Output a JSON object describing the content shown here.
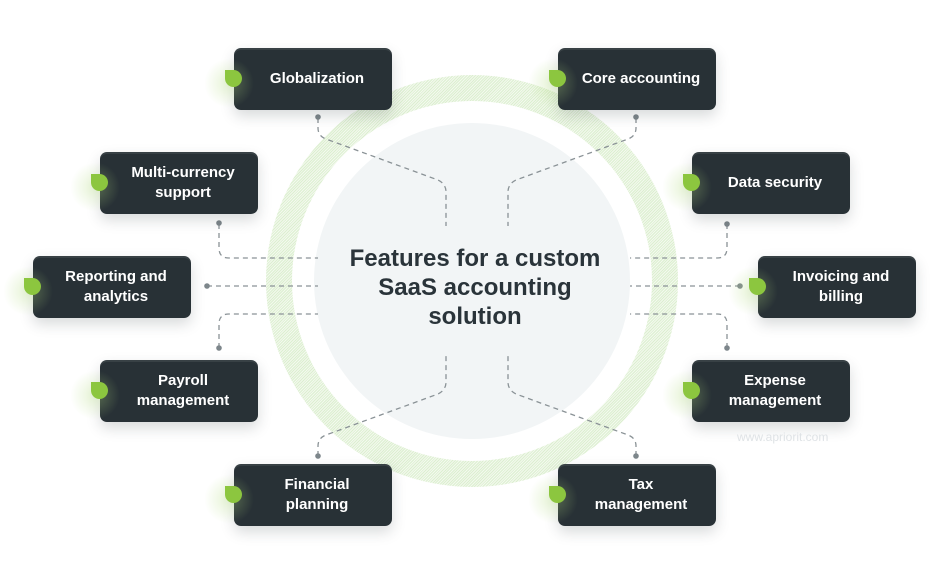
{
  "diagram": {
    "title": "Features for a custom SaaS accounting solution",
    "title_lines": [
      "Features for a custom",
      "SaaS accounting",
      "solution"
    ],
    "watermark": "www.apriorit.com",
    "colors": {
      "node_bg": "#283136",
      "accent": "#8cc63f",
      "title": "#2a343a",
      "connector": "#8a9296"
    },
    "nodes": [
      {
        "id": "globalization",
        "lines": [
          "Globalization"
        ]
      },
      {
        "id": "core-accounting",
        "lines": [
          "Core accounting"
        ]
      },
      {
        "id": "multi-currency",
        "lines": [
          "Multi-currency",
          "support"
        ]
      },
      {
        "id": "data-security",
        "lines": [
          "Data security"
        ]
      },
      {
        "id": "reporting",
        "lines": [
          "Reporting and",
          "analytics"
        ]
      },
      {
        "id": "invoicing",
        "lines": [
          "Invoicing and",
          "billing"
        ]
      },
      {
        "id": "payroll",
        "lines": [
          "Payroll",
          "management"
        ]
      },
      {
        "id": "expense",
        "lines": [
          "Expense",
          "management"
        ]
      },
      {
        "id": "financial-planning",
        "lines": [
          "Financial",
          "planning"
        ]
      },
      {
        "id": "tax",
        "lines": [
          "Tax",
          "management"
        ]
      }
    ]
  }
}
